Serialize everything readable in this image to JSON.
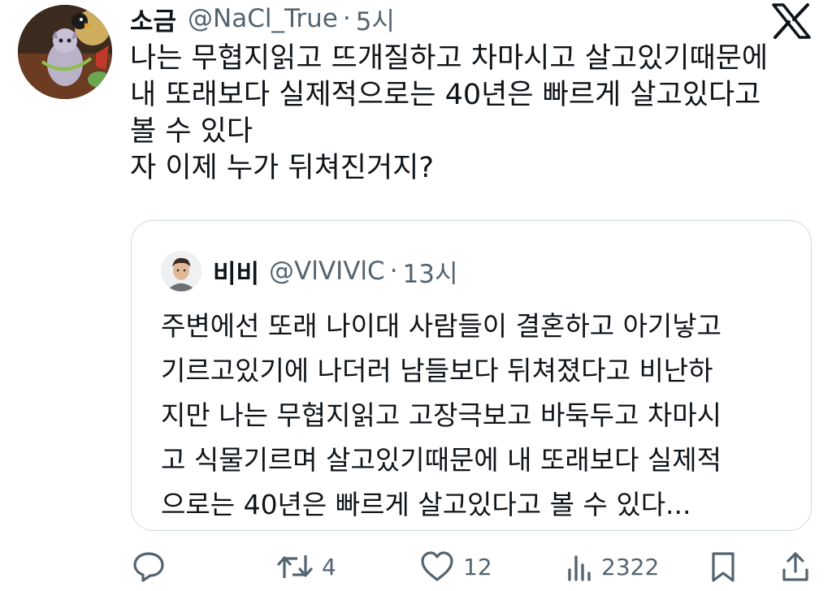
{
  "tweet": {
    "author_name": "소금",
    "author_handle": "@NaCl_True",
    "separator": "·",
    "time": "5시",
    "lines": [
      "나는 무협지읽고 뜨개질하고 차마시고 살고있기때문에",
      "내 또래보다 실제적으로는 40년은 빠르게 살고있다고",
      "볼 수 있다",
      "자 이제 누가 뒤쳐진거지?"
    ]
  },
  "quote": {
    "author_name": "비비",
    "author_handle": "@VlVIVlC",
    "separator": "·",
    "time": "13시",
    "lines": [
      "주변에선 또래 나이대 사람들이 결혼하고 아기낳고",
      "기르고있기에 나더러 남들보다 뒤쳐졌다고 비난하",
      "지만 나는 무협지읽고 고장극보고 바둑두고 차마시",
      "고 식물기르며 살고있기때문에 내 또래보다 실제적",
      "으로는 40년은 빠르게 살고있다고 볼 수 있다..."
    ]
  },
  "actions": {
    "reply": {
      "icon": "reply-icon"
    },
    "retweet": {
      "icon": "retweet-icon",
      "count": "4"
    },
    "like": {
      "icon": "heart-icon",
      "count": "12"
    },
    "views": {
      "icon": "views-icon",
      "count": "2322"
    },
    "bookmark": {
      "icon": "bookmark-icon"
    },
    "share": {
      "icon": "share-icon"
    }
  },
  "colors": {
    "text": "#0f1419",
    "secondary": "#536471",
    "border": "#cfd9de"
  }
}
